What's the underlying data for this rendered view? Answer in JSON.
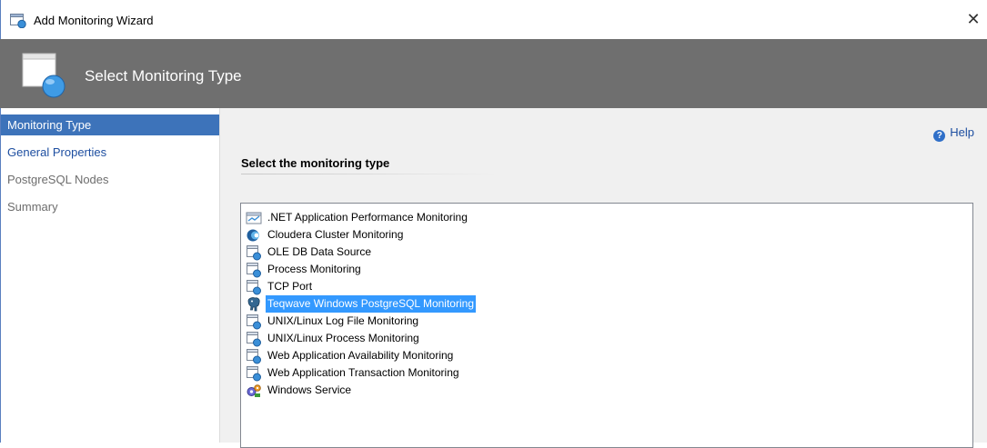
{
  "window": {
    "title": "Add Monitoring Wizard",
    "close_glyph": "✕",
    "icon": "monitoring-wizard-icon"
  },
  "banner": {
    "heading": "Select Monitoring Type",
    "icon": "monitoring-wizard-large-icon"
  },
  "sidebar": {
    "items": [
      {
        "label": "Monitoring Type",
        "state": "active"
      },
      {
        "label": "General Properties",
        "state": "normal"
      },
      {
        "label": "PostgreSQL Nodes",
        "state": "disabled"
      },
      {
        "label": "Summary",
        "state": "disabled"
      }
    ]
  },
  "main": {
    "help_label": "Help",
    "section_title": "Select the monitoring type",
    "types": [
      {
        "label": ".NET Application Performance Monitoring",
        "icon": "dotnet-apm-icon",
        "selected": false
      },
      {
        "label": "Cloudera Cluster Monitoring",
        "icon": "cloudera-icon",
        "selected": false
      },
      {
        "label": "OLE DB Data Source",
        "icon": "monitor-template-icon",
        "selected": false
      },
      {
        "label": "Process Monitoring",
        "icon": "monitor-template-icon",
        "selected": false
      },
      {
        "label": "TCP Port",
        "icon": "monitor-template-icon",
        "selected": false
      },
      {
        "label": "Teqwave Windows PostgreSQL Monitoring",
        "icon": "postgresql-elephant-icon",
        "selected": true
      },
      {
        "label": "UNIX/Linux Log File Monitoring",
        "icon": "monitor-template-icon",
        "selected": false
      },
      {
        "label": "UNIX/Linux Process Monitoring",
        "icon": "monitor-template-icon",
        "selected": false
      },
      {
        "label": "Web Application Availability Monitoring",
        "icon": "monitor-template-icon",
        "selected": false
      },
      {
        "label": "Web Application Transaction Monitoring",
        "icon": "monitor-template-icon",
        "selected": false
      },
      {
        "label": "Windows Service",
        "icon": "windows-service-gears-icon",
        "selected": false
      }
    ]
  },
  "colors": {
    "banner": "#6f6f6f",
    "active_nav": "#3d73ba",
    "selection": "#3399ff",
    "link": "#1d4ea0"
  }
}
